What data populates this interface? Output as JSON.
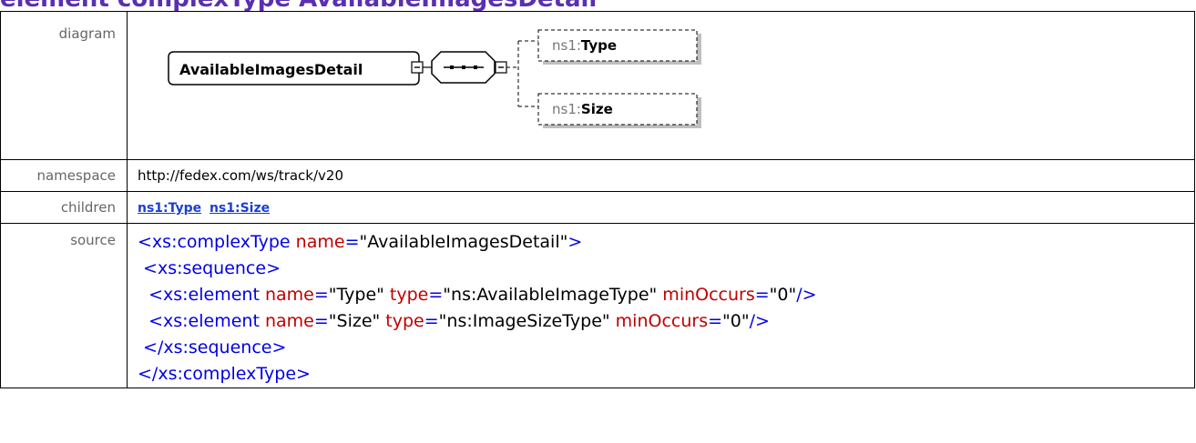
{
  "heading": "element complexType AvailableImagesDetail",
  "rows": {
    "diagram_label": "diagram",
    "namespace_label": "namespace",
    "namespace_value": "http://fedex.com/ws/track/v20",
    "children_label": "children",
    "children": [
      "ns1:Type",
      "ns1:Size"
    ],
    "source_label": "source"
  },
  "diagram": {
    "root": "AvailableImagesDetail",
    "child1_prefix": "ns1:",
    "child1_name": "Type",
    "child2_prefix": "ns1:",
    "child2_name": "Size"
  },
  "source": {
    "l1_tag": "<xs:complexType",
    "l1_att": " name",
    "l1_eq": "=",
    "l1_val": "\"AvailableImagesDetail\"",
    "l1_end": ">",
    "l2_tag": "<xs:sequence>",
    "l3_tag": "<xs:element",
    "l3_a1": " name",
    "l3_v1": "\"Type\"",
    "l3_a2": " type",
    "l3_v2": "\"ns:AvailableImageType\"",
    "l3_a3": " minOccurs",
    "l3_v3": "\"0\"",
    "l3_end": "/>",
    "l4_tag": "<xs:element",
    "l4_a1": " name",
    "l4_v1": "\"Size\"",
    "l4_a2": " type",
    "l4_v2": "\"ns:ImageSizeType\"",
    "l4_a3": " minOccurs",
    "l4_v3": "\"0\"",
    "l4_end": "/>",
    "l5_tag": "</xs:sequence>",
    "l6_tag": "</xs:complexType>"
  },
  "colors": {
    "heading": "#5a2fb0",
    "tag": "#0000e6",
    "attr": "#c00000",
    "link": "#1a3fd1"
  }
}
